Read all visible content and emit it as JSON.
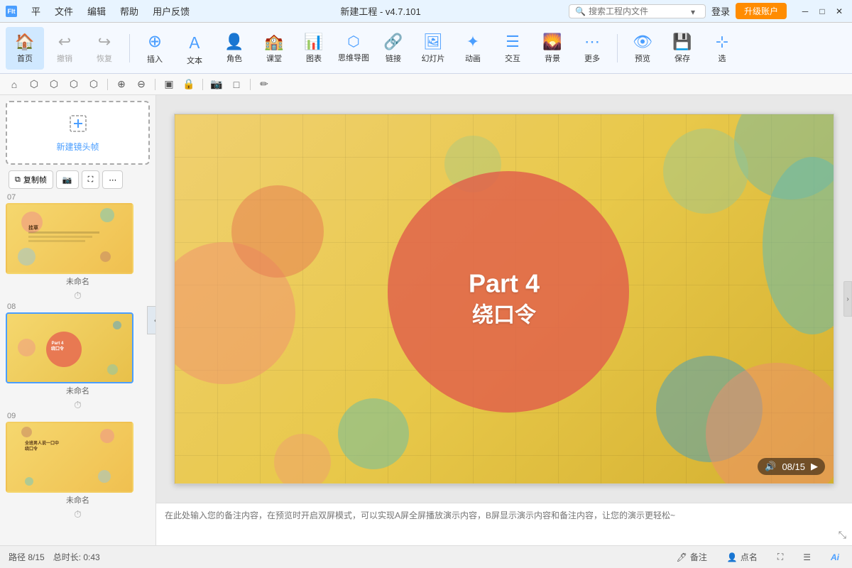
{
  "titleBar": {
    "appIcon": "FIt",
    "menus": [
      "平",
      "文件",
      "编辑",
      "帮助",
      "用户反馈"
    ],
    "title": "新建工程 - v4.7.101",
    "searchPlaceholder": "搜索工程内文件",
    "loginLabel": "登录",
    "upgradeLabel": "升级账户",
    "winMin": "─",
    "winMax": "□",
    "winClose": "✕"
  },
  "toolbar": {
    "items": [
      {
        "id": "home",
        "icon": "🏠",
        "label": "首页"
      },
      {
        "id": "undo",
        "icon": "↩",
        "label": "撤销"
      },
      {
        "id": "redo",
        "icon": "↪",
        "label": "恢复"
      },
      {
        "id": "insert",
        "icon": "⊕",
        "label": "插入"
      },
      {
        "id": "text",
        "icon": "▦",
        "label": "文本"
      },
      {
        "id": "role",
        "icon": "👤",
        "label": "角色"
      },
      {
        "id": "class",
        "icon": "🏫",
        "label": "课堂"
      },
      {
        "id": "chart",
        "icon": "📊",
        "label": "图表"
      },
      {
        "id": "mindmap",
        "icon": "🔀",
        "label": "思维导图"
      },
      {
        "id": "link",
        "icon": "🔗",
        "label": "链接"
      },
      {
        "id": "slideshow",
        "icon": "🖼",
        "label": "幻灯片"
      },
      {
        "id": "animation",
        "icon": "🎬",
        "label": "动画"
      },
      {
        "id": "interact",
        "icon": "👆",
        "label": "交互"
      },
      {
        "id": "background",
        "icon": "🌅",
        "label": "背景"
      },
      {
        "id": "more",
        "icon": "⋯",
        "label": "更多"
      },
      {
        "id": "preview",
        "icon": "👁",
        "label": "预览"
      },
      {
        "id": "save",
        "icon": "💾",
        "label": "保存"
      },
      {
        "id": "select",
        "icon": "⊹",
        "label": "选"
      }
    ]
  },
  "canvasTools": {
    "tools": [
      "⌂",
      "⬡",
      "⬡",
      "⬡",
      "⊕",
      "⊖",
      "▣",
      "🔒",
      "📷",
      "□",
      "✏"
    ]
  },
  "sidebar": {
    "newFrameLabel": "新建镜头帧",
    "copyFrameLabel": "复制帧",
    "cameraLabel": "📷",
    "slides": [
      {
        "number": "07",
        "label": "未命名",
        "active": false
      },
      {
        "number": "08",
        "label": "未命名",
        "active": true
      },
      {
        "number": "09",
        "label": "未命名",
        "active": false
      }
    ]
  },
  "canvas": {
    "mainTitle": "Part 4",
    "subtitle": "绕口令",
    "pageInfo": "08/15"
  },
  "notes": {
    "placeholder": "在此处输入您的备注内容，在预览时开启双屏模式，可以实现A屏全屏播放演示内容，B屏显示演示内容和备注内容，让您的演示更轻松~"
  },
  "statusBar": {
    "path": "路径 8/15",
    "duration": "总时长: 0:43",
    "annotateLabel": "备注",
    "callLabel": "点名",
    "aiLabel": "Ai"
  }
}
